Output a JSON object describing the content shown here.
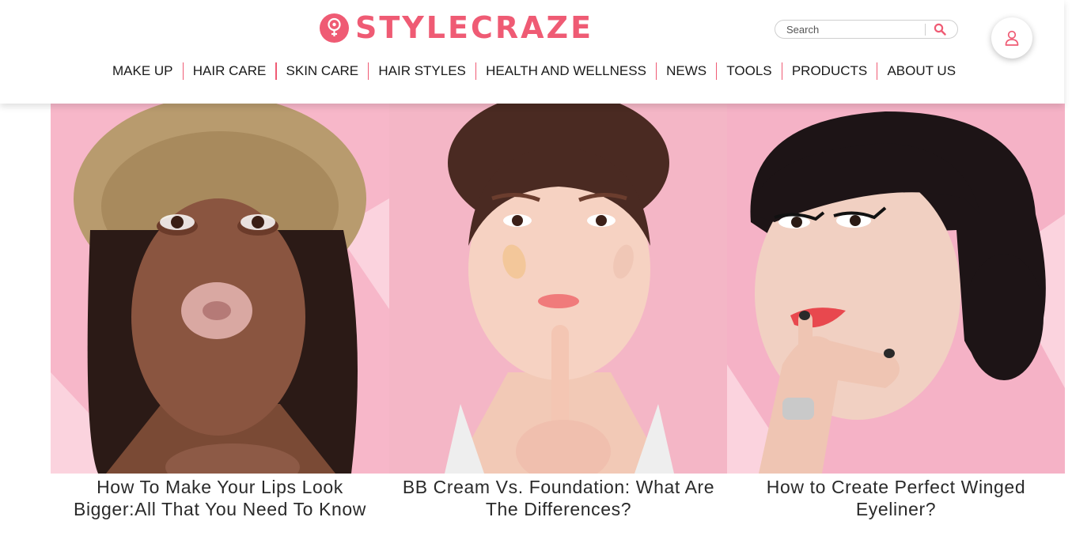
{
  "brand": {
    "name": "STYLECRAZE",
    "color": "#ef5b74"
  },
  "search": {
    "placeholder": "Search",
    "icon": "search-icon"
  },
  "account": {
    "icon": "user-icon"
  },
  "nav": {
    "items": [
      {
        "label": "MAKE UP"
      },
      {
        "label": "HAIR CARE"
      },
      {
        "label": "SKIN CARE"
      },
      {
        "label": "HAIR STYLES"
      },
      {
        "label": "HEALTH AND WELLNESS"
      },
      {
        "label": "NEWS"
      },
      {
        "label": "TOOLS"
      },
      {
        "label": "PRODUCTS"
      },
      {
        "label": "ABOUT US"
      }
    ]
  },
  "articles": [
    {
      "title_line1": "How To Make Your Lips Look",
      "title_line2": "Bigger:All That You Need To Know"
    },
    {
      "title_line1": "BB Cream Vs. Foundation: What Are",
      "title_line2": "The Differences?"
    },
    {
      "title_line1": "How to Create Perfect Winged",
      "title_line2": "Eyeliner?"
    }
  ]
}
